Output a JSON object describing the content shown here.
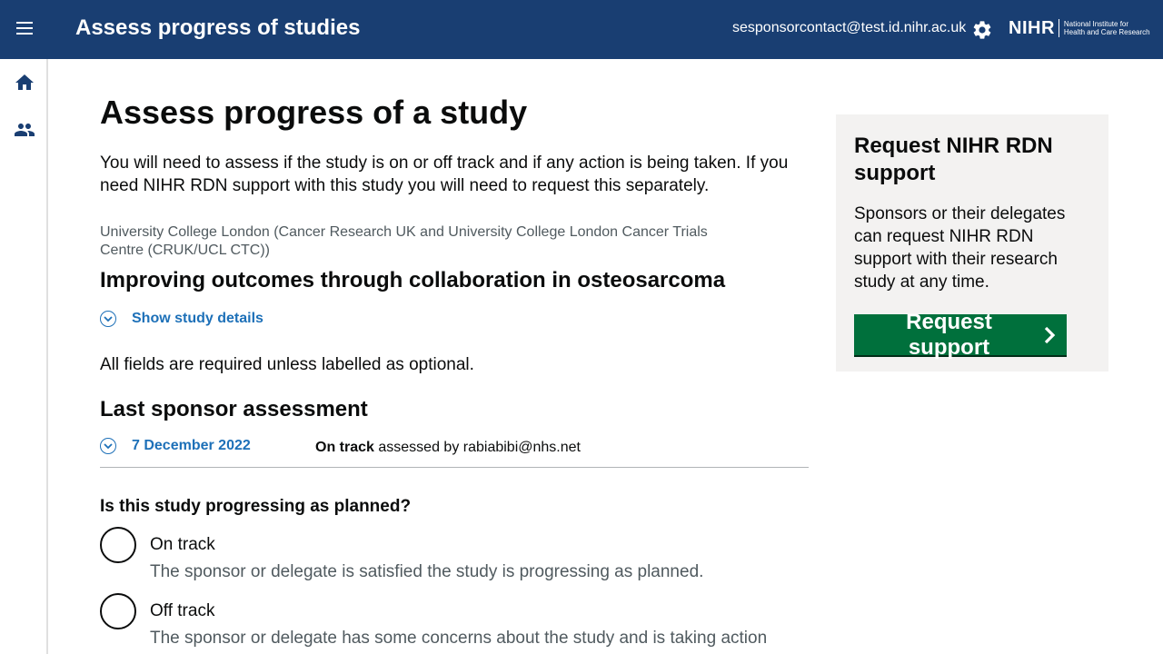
{
  "header": {
    "title": "Assess progress of studies",
    "user_email": "sesponsorcontact@test.id.nihr.ac.uk",
    "logo": {
      "mark": "NIHR",
      "line1": "National Institute for",
      "line2": "Health and Care Research"
    }
  },
  "sidebar": {
    "items": [
      {
        "icon": "home-icon"
      },
      {
        "icon": "people-icon"
      }
    ]
  },
  "main": {
    "page_title": "Assess progress of a study",
    "intro": "You will need to assess if the study is on or off track and if any action is being taken. If you need NIHR RDN support with this study you will need to request this separately.",
    "organisation": "University College London (Cancer Research UK and University College London Cancer Trials Centre (CRUK/UCL CTC))",
    "study_title": "Improving outcomes through collaboration in osteosarcoma",
    "show_details_label": "Show study details",
    "fields_note": "All fields are required unless labelled as optional.",
    "last_assessment": {
      "heading": "Last sponsor assessment",
      "date": "7 December 2022",
      "status": "On track",
      "assessed_by": "assessed by rabiabibi@nhs.net"
    },
    "question": "Is this study progressing as planned?",
    "options": [
      {
        "label": "On track",
        "hint": "The sponsor or delegate is satisfied the study is progressing as planned."
      },
      {
        "label": "Off track",
        "hint": "The sponsor or delegate has some concerns about the study and is taking action"
      }
    ]
  },
  "panel": {
    "heading": "Request NIHR RDN support",
    "body": "Sponsors or their delegates can request NIHR RDN support with their research study at any time.",
    "button_label": "Request support"
  },
  "colors": {
    "header": "#193e72",
    "link": "#1d70b8",
    "button": "#00703c",
    "panel": "#f3f2f1"
  }
}
